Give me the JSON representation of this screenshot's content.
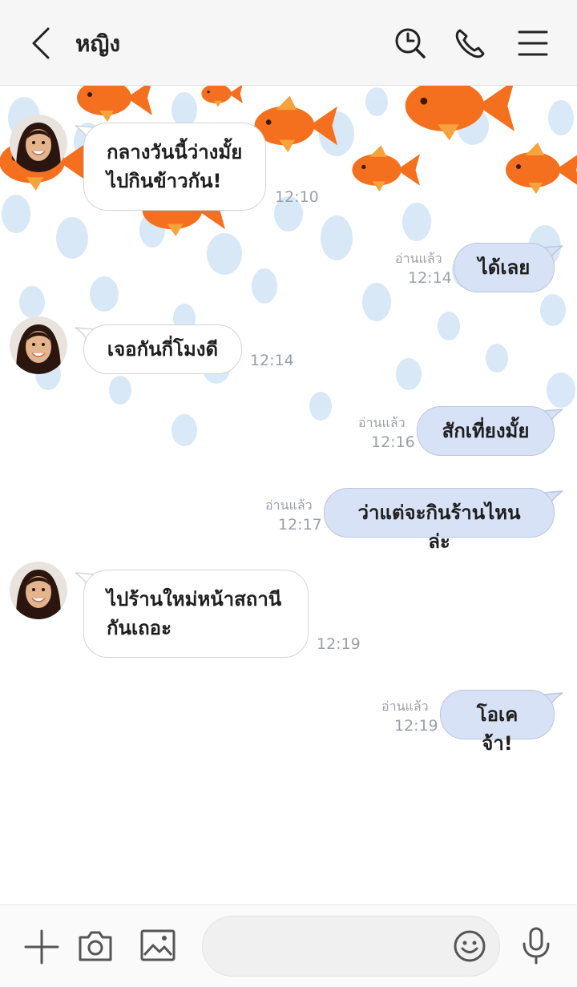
{
  "header": {
    "title": "หญิง",
    "icons": [
      "chevron-left-icon",
      "search-history-icon",
      "phone-icon",
      "menu-icon"
    ]
  },
  "messages": [
    {
      "side": "in",
      "lines": [
        "กลางวันนี้ว่างมั้ย",
        "ไปกินข้าวกัน!"
      ],
      "time": "12:10"
    },
    {
      "side": "out",
      "text": "ได้เลย",
      "status": "อ่านแล้ว",
      "time": "12:14"
    },
    {
      "side": "in",
      "text": "เจอกันกี่โมงดี",
      "time": "12:14"
    },
    {
      "side": "out",
      "text": "สักเที่ยงมั้ย",
      "status": "อ่านแล้ว",
      "time": "12:16"
    },
    {
      "side": "out",
      "text": "ว่าแต่จะกินร้านไหนล่ะ",
      "status": "อ่านแล้ว",
      "time": "12:17"
    },
    {
      "side": "in",
      "lines": [
        "ไปร้านใหม่หน้าสถานี",
        "กันเถอะ"
      ],
      "time": "12:19"
    },
    {
      "side": "out",
      "text": "โอเคจ้า!",
      "status": "อ่านแล้ว",
      "time": "12:19"
    }
  ],
  "input": {
    "placeholder": "",
    "icons": [
      "plus-icon",
      "camera-icon",
      "image-icon",
      "emoji-icon",
      "microphone-icon"
    ]
  },
  "colors": {
    "header_bg": "#f6f6f6",
    "outgoing_bubble": "#d8e2f6",
    "incoming_bubble": "#ffffff",
    "fish": "#f4701f",
    "bubble_dots": "#cfe3f6"
  }
}
